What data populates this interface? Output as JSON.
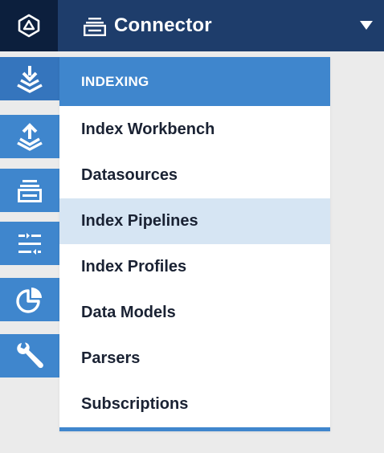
{
  "app": {
    "logo_icon": "triangle-logo-icon",
    "title": "Connector",
    "title_icon": "connector-stack-icon",
    "switcher_icon": "caret-down-icon"
  },
  "sidebar": {
    "items": [
      {
        "name": "indexing",
        "icon": "index-down-arrow-icon",
        "active": true
      },
      {
        "name": "querying",
        "icon": "index-up-arrow-icon",
        "active": false
      },
      {
        "name": "collections",
        "icon": "stack-icon",
        "active": false
      },
      {
        "name": "rules",
        "icon": "sliders-icon",
        "active": false
      },
      {
        "name": "analytics",
        "icon": "pie-chart-icon",
        "active": false
      },
      {
        "name": "system",
        "icon": "wrench-icon",
        "active": false
      }
    ]
  },
  "menu": {
    "header": "INDEXING",
    "items": [
      {
        "label": "Index Workbench",
        "highlighted": false
      },
      {
        "label": "Datasources",
        "highlighted": false
      },
      {
        "label": "Index Pipelines",
        "highlighted": true
      },
      {
        "label": "Index Profiles",
        "highlighted": false
      },
      {
        "label": "Data Models",
        "highlighted": false
      },
      {
        "label": "Parsers",
        "highlighted": false
      },
      {
        "label": "Subscriptions",
        "highlighted": false
      }
    ]
  },
  "colors": {
    "topbar": "#1e3d6b",
    "logo_bg": "#0c1f3d",
    "accent": "#3f86cd",
    "highlight": "#d6e5f3",
    "text": "#1a2233",
    "page_bg": "#ebebeb"
  }
}
